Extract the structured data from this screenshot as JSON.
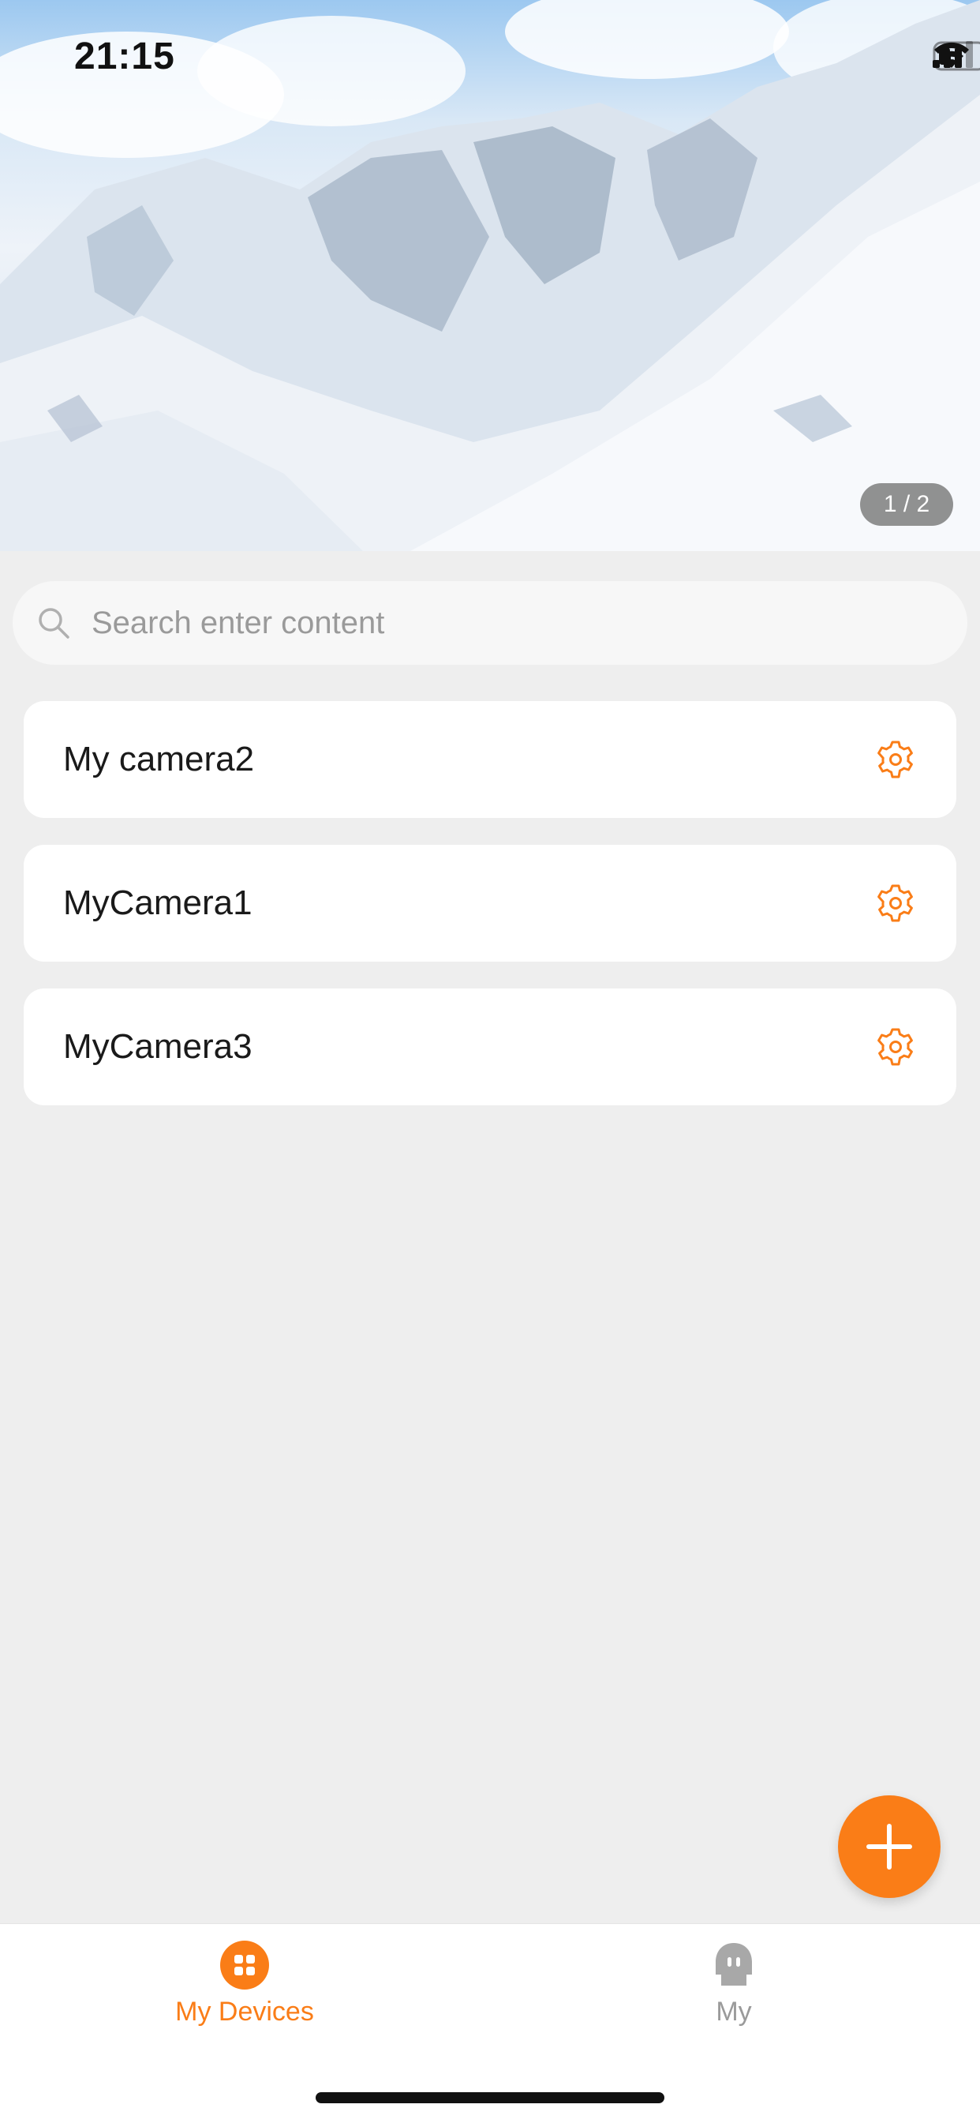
{
  "status_bar": {
    "time": "21:15"
  },
  "banner": {
    "page_indicator": "1 / 2"
  },
  "search": {
    "placeholder": "Search enter content",
    "icon": "search-icon"
  },
  "devices": [
    {
      "name": "My camera2",
      "icon": "gear-icon"
    },
    {
      "name": "MyCamera1",
      "icon": "gear-icon"
    },
    {
      "name": "MyCamera3",
      "icon": "gear-icon"
    }
  ],
  "fab": {
    "icon": "plus-icon"
  },
  "tabbar": {
    "tabs": [
      {
        "label": "My Devices",
        "active": true,
        "icon": "grid-icon"
      },
      {
        "label": "My",
        "active": false,
        "icon": "profile-icon"
      }
    ]
  },
  "colors": {
    "accent": "#fa7d17",
    "inactive": "#9a9a9a",
    "background": "#eeeeee"
  }
}
